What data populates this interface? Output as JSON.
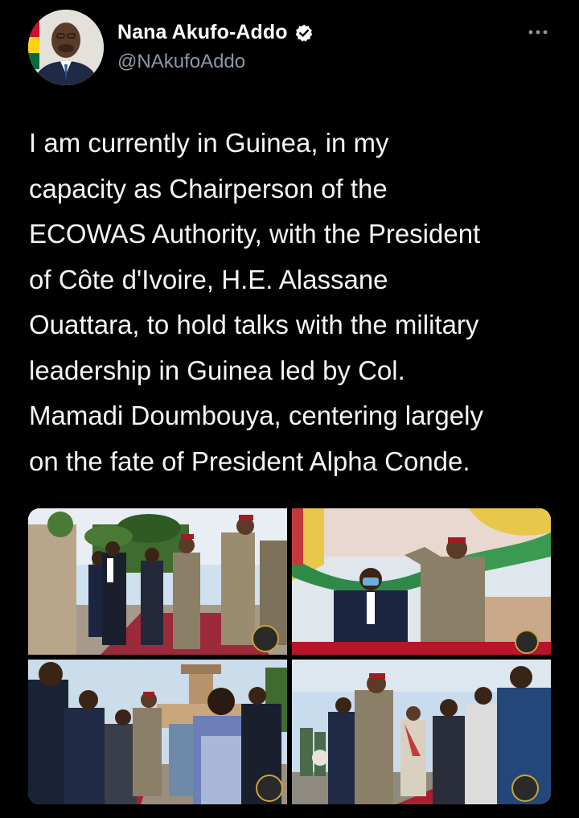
{
  "tweet": {
    "author": {
      "display_name": "Nana Akufo-Addo",
      "handle": "@NAkufoAddo",
      "verified": true,
      "avatar_icon": "profile-photo"
    },
    "menu_icon": "more-options-icon",
    "text_lines": [
      "I am currently in Guinea, in my",
      "capacity as Chairperson of the",
      "ECOWAS Authority, with the President",
      "of Côte d'Ivoire, H.E. Alassane",
      "Ouattara, to hold talks with the military",
      "leadership in Guinea led by Col.",
      "Mamadi Doumbouya, centering largely",
      "on the fate of President Alpha Conde."
    ],
    "media": [
      {
        "icon": "photo-delegation-walking-red-carpet"
      },
      {
        "icon": "photo-soldier-saluting-under-canopy"
      },
      {
        "icon": "photo-delegation-at-airport"
      },
      {
        "icon": "photo-officials-greeting-outdoors"
      }
    ]
  },
  "colors": {
    "background": "#000000",
    "text": "#f5f5f5",
    "secondary_text": "#8b98a5",
    "verified": "#ffffff"
  }
}
